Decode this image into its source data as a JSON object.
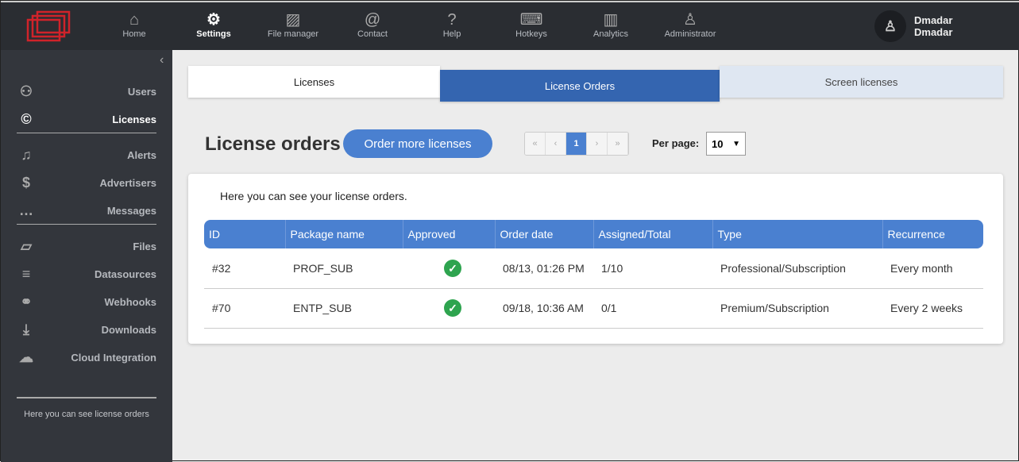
{
  "nav": [
    {
      "label": "Home",
      "icon": "home-icon",
      "glyph": "⌂"
    },
    {
      "label": "Settings",
      "icon": "gear-icon",
      "glyph": "⚙"
    },
    {
      "label": "File manager",
      "icon": "image-icon",
      "glyph": "▨"
    },
    {
      "label": "Contact",
      "icon": "at-icon",
      "glyph": "@"
    },
    {
      "label": "Help",
      "icon": "question-icon",
      "glyph": "?"
    },
    {
      "label": "Hotkeys",
      "icon": "keyboard-icon",
      "glyph": "⌨"
    },
    {
      "label": "Analytics",
      "icon": "chart-icon",
      "glyph": "▥"
    },
    {
      "label": "Administrator",
      "icon": "person-icon",
      "glyph": "♙"
    }
  ],
  "user": {
    "name": "Dmadar",
    "sub": "Dmadar"
  },
  "sidebar": {
    "items": [
      {
        "label": "Users",
        "glyph": "⚇"
      },
      {
        "label": "Licenses",
        "glyph": "©"
      },
      {
        "label": "Alerts",
        "glyph": "♫"
      },
      {
        "label": "Advertisers",
        "glyph": "$"
      },
      {
        "label": "Messages",
        "glyph": "…"
      },
      {
        "label": "Files",
        "glyph": "▱"
      },
      {
        "label": "Datasources",
        "glyph": "≡"
      },
      {
        "label": "Webhooks",
        "glyph": "⚭"
      },
      {
        "label": "Downloads",
        "glyph": "⤓"
      },
      {
        "label": "Cloud Integration",
        "glyph": "☁"
      }
    ],
    "footer": "Here you can see license orders"
  },
  "tabs": [
    "Licenses",
    "License Orders",
    "Screen licenses"
  ],
  "page": {
    "title": "License orders",
    "order_button": "Order more licenses",
    "pager": [
      "«",
      "‹",
      "1",
      "›",
      "»"
    ],
    "per_page_label": "Per page:",
    "per_page_value": "10",
    "description": "Here you can see your license orders."
  },
  "table": {
    "headers": [
      "ID",
      "Package name",
      "Approved",
      "Order date",
      "Assigned/Total",
      "Type",
      "Recurrence"
    ],
    "rows": [
      [
        "#32",
        "PROF_SUB",
        "✓",
        "08/13, 01:26 PM",
        "1/10",
        "Professional/Subscription",
        "Every month"
      ],
      [
        "#70",
        "ENTP_SUB",
        "✓",
        "09/18, 10:36 AM",
        "0/1",
        "Premium/Subscription",
        "Every 2 weeks"
      ]
    ]
  },
  "colors": {
    "accent": "#4a80d0",
    "active_tab": "#3465b0",
    "approved": "#2ea44f"
  }
}
